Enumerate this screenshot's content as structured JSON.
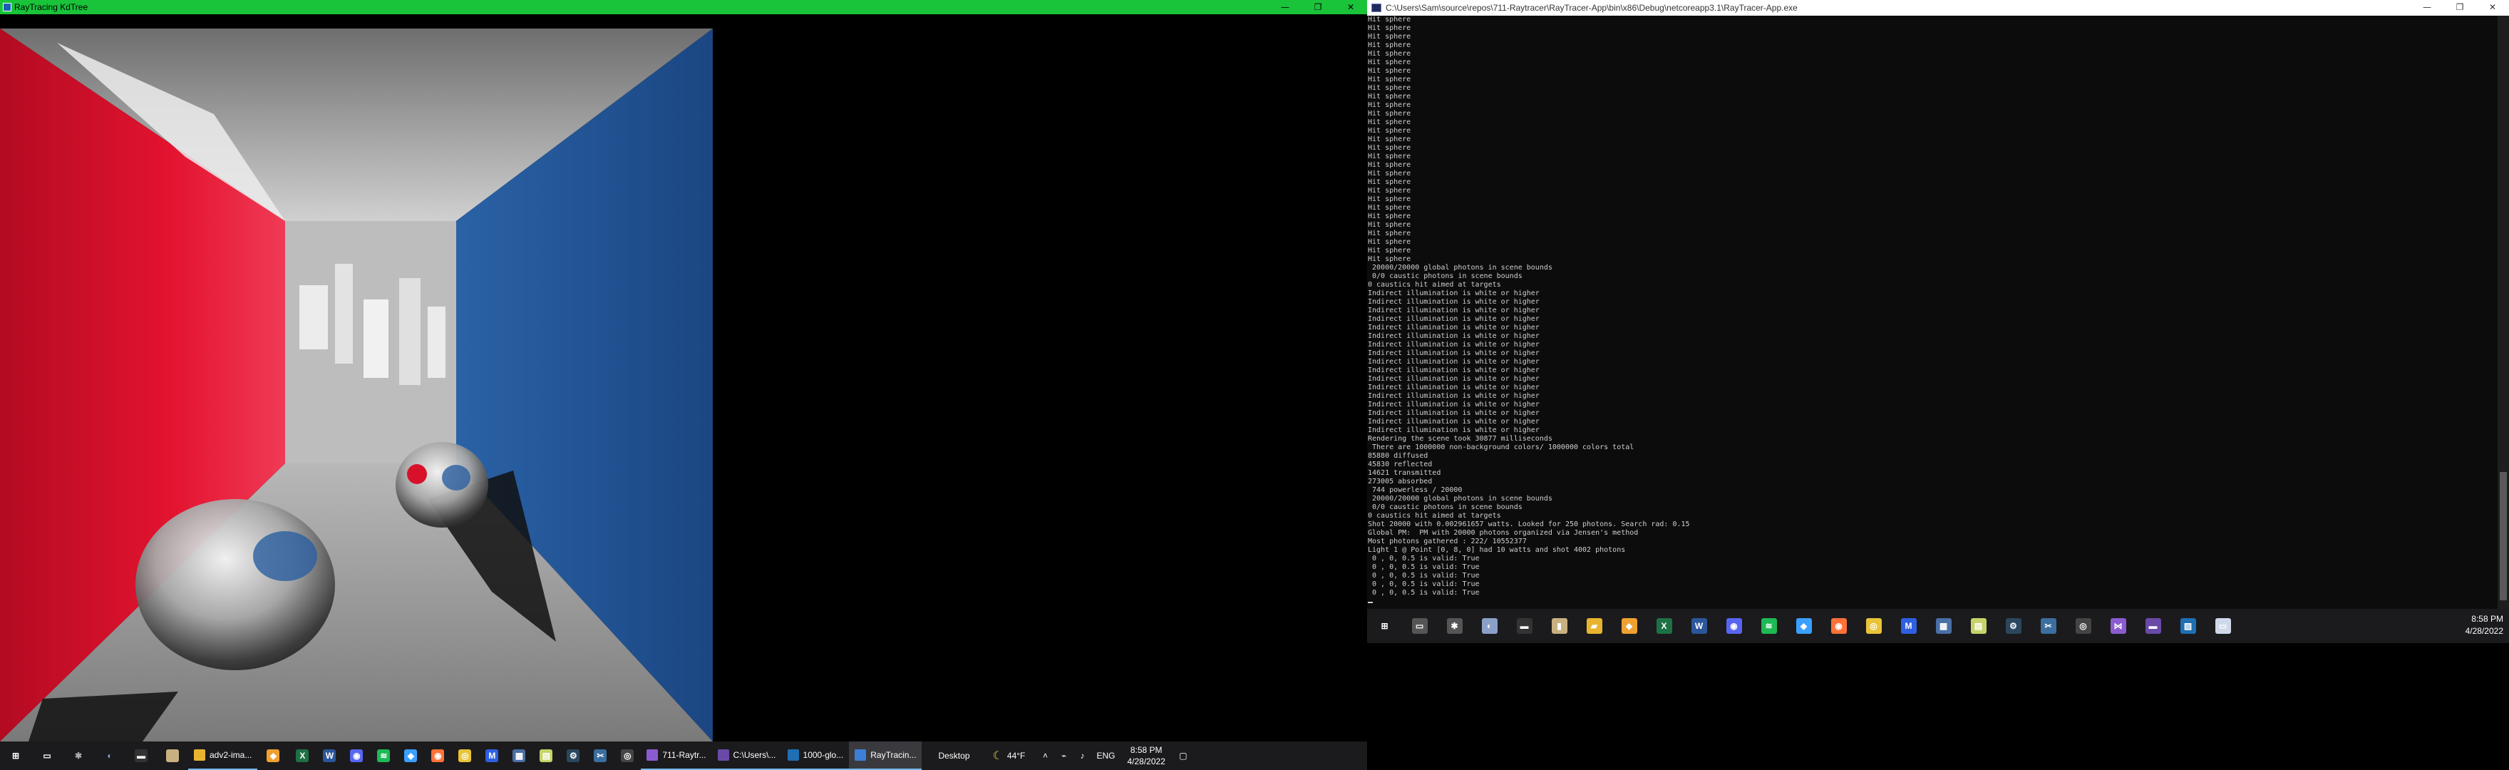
{
  "left_window": {
    "title": "RayTracing KdTree",
    "controls": [
      "—",
      "❐",
      "✕"
    ]
  },
  "render": {
    "colors": {
      "left_wall": "#d8112b",
      "right_wall": "#1b4f8f",
      "floor": "#9a9a9a",
      "ceiling": "#c8c8c8",
      "back_wall": "#b8b8b8",
      "titlebar": "#19c33a"
    }
  },
  "left_taskbar": {
    "pinned_icons": [
      "windows-start-icon",
      "task-view-icon",
      "cat-icon",
      "paint-icon",
      "terminal-icon",
      "book-icon"
    ],
    "apps": [
      {
        "label": "adv2-ima...",
        "icon": "folder-icon",
        "color": "#e8b430",
        "active": false
      },
      {
        "label": "",
        "icon": "git-icon",
        "color": "#f0a030",
        "active": false
      }
    ],
    "pinned_icons_2": [
      {
        "icon": "excel-icon",
        "color": "#1e7145",
        "glyph": "X"
      },
      {
        "icon": "word-icon",
        "color": "#2b579a",
        "glyph": "W"
      },
      {
        "icon": "discord-icon",
        "color": "#5865f2",
        "glyph": "◉"
      },
      {
        "icon": "spotify-icon",
        "color": "#1db954",
        "glyph": "≋"
      },
      {
        "icon": "firefox-dev-icon",
        "color": "#3aa0ff",
        "glyph": "◆"
      },
      {
        "icon": "firefox-icon",
        "color": "#ff7139",
        "glyph": "◉"
      },
      {
        "icon": "chrome-icon",
        "color": "#e9c439",
        "glyph": "◎"
      },
      {
        "icon": "malwarebytes-icon",
        "color": "#2f60e3",
        "glyph": "M"
      },
      {
        "icon": "calculator-icon",
        "color": "#4a6fa5",
        "glyph": "▦"
      },
      {
        "icon": "notepad-icon",
        "color": "#c7d36a",
        "glyph": "▤"
      },
      {
        "icon": "steam-icon",
        "color": "#2a475e",
        "glyph": "⚙"
      },
      {
        "icon": "snipping-icon",
        "color": "#3c6e9f",
        "glyph": "✂"
      },
      {
        "icon": "obs-icon",
        "color": "#444",
        "glyph": "◎"
      }
    ],
    "windows": [
      {
        "label": "711-Raytr...",
        "icon": "visual-studio-icon",
        "color": "#8a5cd0",
        "active": false
      },
      {
        "label": "C:\\Users\\...",
        "icon": "console-icon",
        "color": "#6a4aa8",
        "active": false
      },
      {
        "label": "1000-glo...",
        "icon": "image-icon",
        "color": "#1f6fb2",
        "active": false
      },
      {
        "label": "RayTracin...",
        "icon": "raytracer-icon",
        "color": "#3e7fd6",
        "active": true
      }
    ],
    "desktop_label": "Desktop",
    "weather": "44°F",
    "language": "ENG",
    "time": "8:58 PM",
    "date": "4/28/2022"
  },
  "console": {
    "title": "C:\\Users\\Sam\\source\\repos\\711-Raytracer\\RayTracer-App\\bin\\x86\\Debug\\netcoreapp3.1\\RayTracer-App.exe",
    "controls": [
      "—",
      "❐",
      "✕"
    ],
    "lines": [
      "Hit sphere",
      "Hit sphere",
      "Hit sphere",
      "Hit sphere",
      "Hit sphere",
      "Hit sphere",
      "Hit sphere",
      "Hit sphere",
      "Hit sphere",
      "Hit sphere",
      "Hit sphere",
      "Hit sphere",
      "Hit sphere",
      "Hit sphere",
      "Hit sphere",
      "Hit sphere",
      "Hit sphere",
      "Hit sphere",
      "Hit sphere",
      "Hit sphere",
      "Hit sphere",
      "Hit sphere",
      "Hit sphere",
      "Hit sphere",
      "Hit sphere",
      "Hit sphere",
      "Hit sphere",
      "Hit sphere",
      "Hit sphere",
      " 20000/20000 global photons in scene bounds",
      " 0/0 caustic photons in scene bounds",
      "0 caustics hit aimed at targets",
      "Indirect illumination is white or higher",
      "Indirect illumination is white or higher",
      "Indirect illumination is white or higher",
      "Indirect illumination is white or higher",
      "Indirect illumination is white or higher",
      "Indirect illumination is white or higher",
      "Indirect illumination is white or higher",
      "Indirect illumination is white or higher",
      "Indirect illumination is white or higher",
      "Indirect illumination is white or higher",
      "Indirect illumination is white or higher",
      "Indirect illumination is white or higher",
      "Indirect illumination is white or higher",
      "Indirect illumination is white or higher",
      "Indirect illumination is white or higher",
      "Indirect illumination is white or higher",
      "Indirect illumination is white or higher",
      "Rendering the scene took 30877 milliseconds",
      " There are 1000000 non-background colors/ 1000000 colors total",
      "85880 diffused",
      "45830 reflected",
      "14621 transmitted",
      "273005 absorbed",
      " 744 powerless / 20000",
      " 20000/20000 global photons in scene bounds",
      " 0/0 caustic photons in scene bounds",
      "0 caustics hit aimed at targets",
      "Shot 20000 with 0.002961657 watts. Looked for 250 photons. Search rad: 0.15",
      "Global PM:  PM with 20000 photons organized via Jensen's method",
      "Most photons gathered : 222/ 10552377",
      "Light 1 @ Point [0, 8, 0] had 10 watts and shot 4002 photons",
      " 0 , 0, 0.5 is valid: True",
      " 0 , 0, 0.5 is valid: True",
      " 0 , 0, 0.5 is valid: True",
      " 0 , 0, 0.5 is valid: True",
      " 0 , 0, 0.5 is valid: True"
    ]
  },
  "right_taskbar": {
    "icons": [
      {
        "icon": "windows-start-icon",
        "color": "#ffffff",
        "glyph": "⊞"
      },
      {
        "icon": "task-view-icon",
        "color": "#555",
        "glyph": "▭"
      },
      {
        "icon": "cat-icon",
        "color": "#555",
        "glyph": "✱"
      },
      {
        "icon": "paint-icon",
        "color": "#8aa0c8",
        "glyph": "◐"
      },
      {
        "icon": "terminal-icon",
        "color": "#333",
        "glyph": "▬"
      },
      {
        "icon": "book-icon",
        "color": "#c8b080",
        "glyph": "▮"
      },
      {
        "icon": "folder-icon",
        "color": "#e8b430",
        "glyph": "▰"
      },
      {
        "icon": "git-icon",
        "color": "#f0a030",
        "glyph": "◆"
      },
      {
        "icon": "excel-icon",
        "color": "#1e7145",
        "glyph": "X"
      },
      {
        "icon": "word-icon",
        "color": "#2b579a",
        "glyph": "W"
      },
      {
        "icon": "discord-icon",
        "color": "#5865f2",
        "glyph": "◉"
      },
      {
        "icon": "spotify-icon",
        "color": "#1db954",
        "glyph": "≋"
      },
      {
        "icon": "firefox-dev-icon",
        "color": "#3aa0ff",
        "glyph": "◆"
      },
      {
        "icon": "firefox-icon",
        "color": "#ff7139",
        "glyph": "◉"
      },
      {
        "icon": "chrome-icon",
        "color": "#e9c439",
        "glyph": "◎"
      },
      {
        "icon": "malwarebytes-icon",
        "color": "#2f60e3",
        "glyph": "M"
      },
      {
        "icon": "calculator-icon",
        "color": "#4a6fa5",
        "glyph": "▦"
      },
      {
        "icon": "notepad-icon",
        "color": "#c7d36a",
        "glyph": "▤"
      },
      {
        "icon": "steam-icon",
        "color": "#2a475e",
        "glyph": "⚙"
      },
      {
        "icon": "snipping-icon",
        "color": "#3c6e9f",
        "glyph": "✂"
      },
      {
        "icon": "obs-icon",
        "color": "#444",
        "glyph": "◎"
      },
      {
        "icon": "visual-studio-icon",
        "color": "#8a5cd0",
        "glyph": "⋈"
      },
      {
        "icon": "console-icon",
        "color": "#6a4aa8",
        "glyph": "▬"
      },
      {
        "icon": "image-icon",
        "color": "#1f6fb2",
        "glyph": "▨"
      },
      {
        "icon": "raytracer-icon",
        "color": "#cfd8e8",
        "glyph": "▭"
      }
    ],
    "time": "8:58 PM",
    "date": "4/28/2022"
  }
}
